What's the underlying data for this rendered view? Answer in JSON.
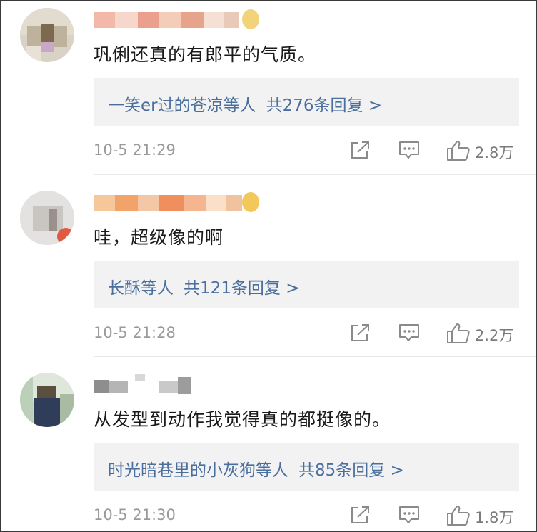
{
  "comments": [
    {
      "content": "巩俐还真的有郎平的气质。",
      "reply_names": "一笑er过的苍凉等人",
      "reply_count": "共276条回复 >",
      "time": "10-5 21:29",
      "likes": "2.8万",
      "icons": [
        "share-icon",
        "comment-icon",
        "like-icon"
      ]
    },
    {
      "content": "哇，超级像的啊",
      "reply_names": "长酥等人",
      "reply_count": "共121条回复 >",
      "time": "10-5 21:28",
      "likes": "2.2万",
      "icons": [
        "share-icon",
        "comment-icon",
        "like-icon"
      ]
    },
    {
      "content": "从发型到动作我觉得真的都挺像的。",
      "reply_names": "时光暗巷里的小灰狗等人",
      "reply_count": "共85条回复 >",
      "time": "10-5 21:30",
      "likes": "1.8万",
      "icons": [
        "share-icon",
        "comment-icon",
        "like-icon"
      ]
    }
  ],
  "colors": {
    "link": "#4a6f9e",
    "meta": "#9a9a9a",
    "reply_bg": "#f2f2f2"
  }
}
